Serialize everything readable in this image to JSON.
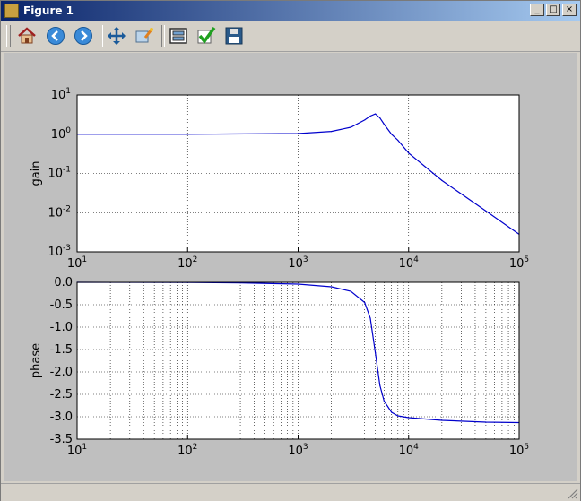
{
  "window": {
    "title": "Figure 1"
  },
  "title_buttons": {
    "minimize": "_",
    "maximize": "□",
    "close": "×"
  },
  "toolbar": {
    "buttons": [
      {
        "name": "home",
        "icon": "home-icon"
      },
      {
        "name": "back",
        "icon": "arrow-left-icon"
      },
      {
        "name": "forward",
        "icon": "arrow-right-icon"
      },
      {
        "name": "pan",
        "icon": "move-arrows-icon"
      },
      {
        "name": "zoom",
        "icon": "zoom-rect-icon"
      },
      {
        "name": "subplots",
        "icon": "subplots-icon"
      },
      {
        "name": "edit",
        "icon": "checkmark-icon"
      },
      {
        "name": "save",
        "icon": "floppy-disk-icon"
      }
    ]
  },
  "colors": {
    "line": "#0000cc",
    "canvas_bg": "#bfbfbf",
    "axes_bg": "#ffffff"
  },
  "chart_data": [
    {
      "type": "line",
      "ylabel": "gain",
      "xscale": "log",
      "yscale": "log",
      "xlim": [
        10,
        100000
      ],
      "ylim": [
        0.001,
        10
      ],
      "grid": true,
      "xticks": [
        "10^1",
        "10^2",
        "10^3",
        "10^4",
        "10^5"
      ],
      "yticks": [
        "10^-3",
        "10^-2",
        "10^-1",
        "10^0",
        "10^1"
      ],
      "x": [
        10,
        100,
        1000,
        2000,
        3000,
        4000,
        4500,
        5000,
        5500,
        6000,
        7000,
        8000,
        10000,
        20000,
        50000,
        100000
      ],
      "y": [
        1.0,
        1.0,
        1.04,
        1.18,
        1.5,
        2.3,
        2.9,
        3.3,
        2.6,
        1.8,
        1.0,
        0.7,
        0.33,
        0.066,
        0.011,
        0.0028
      ]
    },
    {
      "type": "line",
      "ylabel": "phase",
      "xscale": "log",
      "yscale": "linear",
      "xlim": [
        10,
        100000
      ],
      "ylim": [
        -3.5,
        0.0
      ],
      "grid": true,
      "xticks": [
        "10^1",
        "10^2",
        "10^3",
        "10^4",
        "10^5"
      ],
      "yticks": [
        "0.0",
        "-0.5",
        "-1.0",
        "-1.5",
        "-2.0",
        "-2.5",
        "-3.0",
        "-3.5"
      ],
      "x": [
        10,
        100,
        300,
        1000,
        2000,
        3000,
        4000,
        4500,
        5000,
        5500,
        6000,
        7000,
        8000,
        10000,
        20000,
        50000,
        100000
      ],
      "y": [
        0.0,
        -0.004,
        -0.012,
        -0.04,
        -0.1,
        -0.2,
        -0.45,
        -0.8,
        -1.57,
        -2.3,
        -2.65,
        -2.9,
        -2.98,
        -3.02,
        -3.08,
        -3.12,
        -3.13
      ]
    }
  ]
}
